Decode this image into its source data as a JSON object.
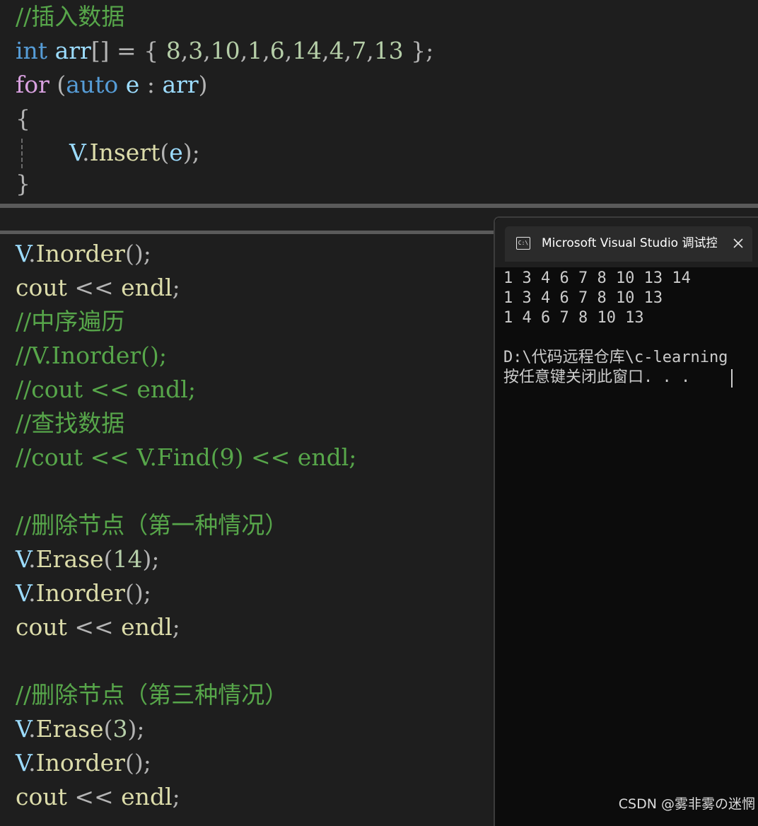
{
  "top_pane": {
    "comment_insert": "//插入数据",
    "arr_type": "int",
    "arr_name": "arr",
    "arr_brackets": "[]",
    "arr_assign": " = { ",
    "arr_values": [
      "8",
      "3",
      "10",
      "1",
      "6",
      "14",
      "4",
      "7",
      "13"
    ],
    "arr_close": " };",
    "for_kw": "for",
    "for_open": " (",
    "auto_kw": "auto",
    "loop_var": " e",
    "colon": " : ",
    "loop_range": "arr",
    "for_close": ")",
    "brace_open": "{",
    "insert_obj": "V",
    "insert_dot": ".",
    "insert_fn": "Insert",
    "insert_open": "(",
    "insert_arg": "e",
    "insert_close": ");",
    "brace_close": "}"
  },
  "bottom_pane": {
    "line1_obj": "V",
    "line1_dot": ".",
    "line1_fn": "Inorder",
    "line1_rest": "();",
    "line2_a": "cout",
    "line2_op": " << ",
    "line2_b": "endl",
    "line2_semi": ";",
    "comment_inorder": "//中序遍历",
    "comment_inorder_call": "//V.Inorder();",
    "comment_cout": "//cout << endl;",
    "comment_find": "//查找数据",
    "comment_find_call": "//cout << V.Find(9) << endl;",
    "comment_erase1": "//删除节点（第一种情况）",
    "erase1_obj": "V",
    "erase1_dot": ".",
    "erase1_fn": "Erase",
    "erase1_open": "(",
    "erase1_arg": "14",
    "erase1_close": ");",
    "inorder2_obj": "V",
    "inorder2_dot": ".",
    "inorder2_fn": "Inorder",
    "inorder2_rest": "();",
    "cout2_a": "cout",
    "cout2_op": " << ",
    "cout2_b": "endl",
    "cout2_semi": ";",
    "comment_erase3": "//删除节点（第三种情况）",
    "erase3_obj": "V",
    "erase3_dot": ".",
    "erase3_fn": "Erase",
    "erase3_open": "(",
    "erase3_arg": "3",
    "erase3_close": ");",
    "inorder3_obj": "V",
    "inorder3_dot": ".",
    "inorder3_fn": "Inorder",
    "inorder3_rest": "();",
    "cout3_a": "cout",
    "cout3_op": " << ",
    "cout3_b": "endl",
    "cout3_semi": ";"
  },
  "console": {
    "title": "Microsoft Visual Studio 调试控制台",
    "icon": "console-icon",
    "close_icon": "close-icon",
    "output_lines": [
      "1 3 4 6 7 8 10 13 14",
      "1 3 4 6 7 8 10 13",
      "1 4 6 7 8 10 13",
      "",
      "D:\\代码远程仓库\\c-learning",
      "按任意键关闭此窗口. . ."
    ]
  },
  "watermark": "CSDN @雾非雾の迷惘",
  "colors": {
    "background": "#1e1e1e",
    "keyword": "#569cd6",
    "function": "#dcdcaa",
    "variable": "#9cdcfe",
    "number": "#b5cea8",
    "comment": "#57a64a",
    "console_bg": "#0c0c0c"
  }
}
